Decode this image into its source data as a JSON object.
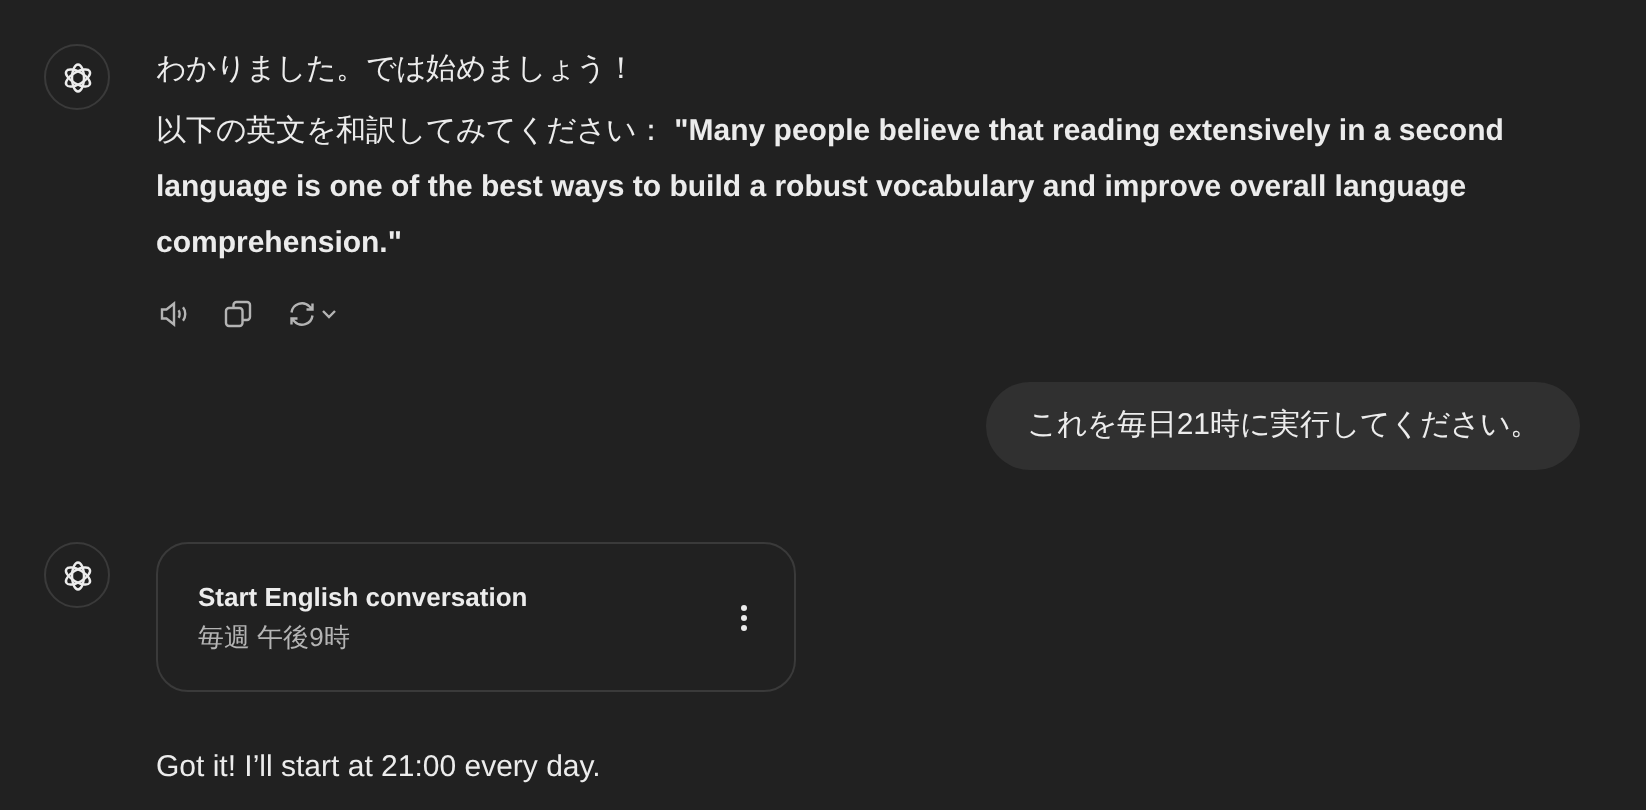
{
  "messages": [
    {
      "kind": "assistant_text",
      "paragraphs": [
        "わかりました。では始めましょう！",
        "以下の英文を和訳してみてください： **\"Many people believe that reading extensively in a second language is one of the best ways to build a robust vocabulary and improve overall language comprehension.\"**"
      ]
    },
    {
      "kind": "user",
      "text": "これを毎日21時に実行してください。"
    },
    {
      "kind": "assistant_task",
      "task": {
        "title": "Start English conversation",
        "schedule": "毎週 午後9時"
      },
      "paragraphs": [
        "Got it! I’ll start at 21:00 every day."
      ]
    }
  ]
}
